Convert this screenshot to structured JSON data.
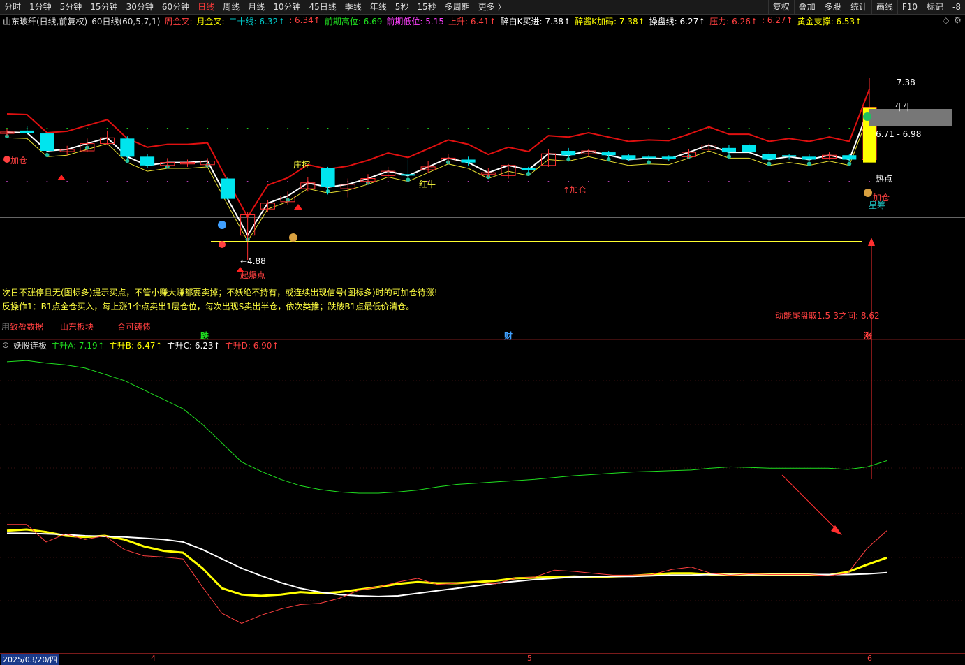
{
  "toolbar": {
    "periods": [
      "分时",
      "1分钟",
      "5分钟",
      "15分钟",
      "30分钟",
      "60分钟",
      "日线",
      "周线",
      "月线",
      "10分钟",
      "45日线",
      "季线",
      "年线",
      "5秒",
      "15秒",
      "多周期",
      "更多 〉"
    ],
    "active": "日线",
    "right_buttons": [
      "复权",
      "叠加",
      "多股",
      "统计",
      "画线",
      "F10",
      "标记",
      "-8"
    ]
  },
  "infobar": {
    "stock": "山东玻纤(日线,前复权)",
    "indicator": "60日线(60,5,7,1)",
    "items": [
      {
        "text": "周金叉:",
        "color": "#ff4040"
      },
      {
        "text": "月金叉:",
        "color": "#ffff00"
      },
      {
        "text": "二十线: 6.32↑",
        "color": "#00c8c8"
      },
      {
        "text": ": 6.34↑",
        "color": "#ff4040"
      },
      {
        "text": "前期高位: 6.69",
        "color": "#20e020"
      },
      {
        "text": "前期低位: 5.15",
        "color": "#ff40ff"
      },
      {
        "text": "上升: 6.41↑",
        "color": "#ff4040"
      },
      {
        "text": "醉白K买进: 7.38↑",
        "color": "#ffffff"
      },
      {
        "text": "醉酱K加码: 7.38↑",
        "color": "#ffff00"
      },
      {
        "text": "操盘线: 6.27↑",
        "color": "#ffffff"
      },
      {
        "text": "压力: 6.26↑",
        "color": "#ff4040"
      },
      {
        "text": ": 6.27↑",
        "color": "#ff4040"
      },
      {
        "text": "黄金支撑: 6.53↑",
        "color": "#ffff00"
      }
    ]
  },
  "controls": [
    "◇",
    "⚙"
  ],
  "annotations": {
    "jiacang1": "加仓",
    "zhuangkong": "庄控",
    "hongniu": "红牛",
    "jiacang2": "↑加仓",
    "price_high": "7.38",
    "range": "6.71 - 6.98",
    "niuniu": "牛牛",
    "redian": "热点",
    "jiacang3": "加仓",
    "xingchou": "星筹",
    "price_low": "←4.88",
    "qibaodian": "起爆点"
  },
  "notes": {
    "line1": "次日不涨停且无(图标多)提示买点，不管小赚大赚都要卖掉；不妖绝不持有，或连续出现信号(图标多)时的可加仓待涨!",
    "line2": "反操作1：B1点全仓买入，每上涨1个点卖出1层仓位，每次出现S卖出半仓，依次类推；跌破B1点最低价清仓。",
    "momentum": "动能尾盘取1.5-3之间:   8.62",
    "tags": [
      {
        "text": "用",
        "color": "#888"
      },
      {
        "text": "致盈数据",
        "color": "#ff4040"
      },
      {
        "text": "山东板块",
        "color": "#ff4040"
      },
      {
        "text": "合可铸债",
        "color": "#ff4040"
      }
    ],
    "markers": [
      {
        "text": "跌",
        "color": "#20e020"
      },
      {
        "text": "财",
        "color": "#40a0ff"
      },
      {
        "text": "涨",
        "color": "#ff4040"
      }
    ]
  },
  "sub_legend": {
    "title": "妖股连板",
    "items": [
      {
        "text": "主升A: 7.19↑",
        "color": "#20e020"
      },
      {
        "text": "主升B: 6.47↑",
        "color": "#ffff00"
      },
      {
        "text": "主升C: 6.23↑",
        "color": "#ffffff"
      },
      {
        "text": "主升D: 6.90↑",
        "color": "#ff4040"
      }
    ]
  },
  "bottom_axis": {
    "date": "2025/03/20/四",
    "months": [
      "4",
      "5",
      "6"
    ]
  },
  "chart_data": [
    {
      "type": "candlestick",
      "title": "山东玻纤(日线,前复权)",
      "annotated_high": 7.38,
      "annotated_low": 4.88,
      "annotated_range": [
        6.71,
        6.98
      ],
      "candles": [
        {
          "o": 6.62,
          "c": 6.64,
          "h": 6.68,
          "l": 6.58,
          "up": true
        },
        {
          "o": 6.66,
          "c": 6.63,
          "h": 6.72,
          "l": 6.6,
          "up": false
        },
        {
          "o": 6.62,
          "c": 6.38,
          "h": 6.64,
          "l": 6.3,
          "up": false
        },
        {
          "o": 6.37,
          "c": 6.4,
          "h": 6.45,
          "l": 6.32,
          "up": true
        },
        {
          "o": 6.38,
          "c": 6.48,
          "h": 6.55,
          "l": 6.36,
          "up": true
        },
        {
          "o": 6.48,
          "c": 6.56,
          "h": 6.66,
          "l": 6.46,
          "up": true
        },
        {
          "o": 6.55,
          "c": 6.3,
          "h": 6.58,
          "l": 6.26,
          "up": false
        },
        {
          "o": 6.3,
          "c": 6.18,
          "h": 6.34,
          "l": 6.14,
          "up": false
        },
        {
          "o": 6.18,
          "c": 6.22,
          "h": 6.28,
          "l": 6.14,
          "up": true
        },
        {
          "o": 6.2,
          "c": 6.22,
          "h": 6.26,
          "l": 6.16,
          "up": true
        },
        {
          "o": 6.19,
          "c": 6.24,
          "h": 6.28,
          "l": 6.16,
          "up": true
        },
        {
          "o": 6.0,
          "c": 5.72,
          "h": 6.02,
          "l": 5.7,
          "up": false
        },
        {
          "o": 5.5,
          "c": 5.22,
          "h": 5.54,
          "l": 4.88,
          "up": true
        },
        {
          "o": 5.58,
          "c": 5.66,
          "h": 5.7,
          "l": 5.54,
          "up": true
        },
        {
          "o": 5.68,
          "c": 5.76,
          "h": 5.82,
          "l": 5.64,
          "up": true
        },
        {
          "o": 5.86,
          "c": 5.94,
          "h": 6.02,
          "l": 5.82,
          "up": true
        },
        {
          "o": 6.14,
          "c": 5.88,
          "h": 6.16,
          "l": 5.78,
          "up": false
        },
        {
          "o": 5.86,
          "c": 5.92,
          "h": 6.0,
          "l": 5.74,
          "up": true
        },
        {
          "o": 5.96,
          "c": 6.0,
          "h": 6.06,
          "l": 5.92,
          "up": true
        },
        {
          "o": 6.04,
          "c": 6.1,
          "h": 6.16,
          "l": 6.0,
          "up": true
        },
        {
          "o": 6.06,
          "c": 6.04,
          "h": 6.26,
          "l": 6.0,
          "up": false
        },
        {
          "o": 6.12,
          "c": 6.16,
          "h": 6.24,
          "l": 6.08,
          "up": true
        },
        {
          "o": 6.24,
          "c": 6.28,
          "h": 6.34,
          "l": 6.2,
          "up": true
        },
        {
          "o": 6.26,
          "c": 6.22,
          "h": 6.3,
          "l": 6.18,
          "up": false
        },
        {
          "o": 6.06,
          "c": 6.08,
          "h": 6.14,
          "l": 6.02,
          "up": true
        },
        {
          "o": 6.04,
          "c": 6.18,
          "h": 6.2,
          "l": 6.0,
          "up": true
        },
        {
          "o": 6.14,
          "c": 6.12,
          "h": 6.16,
          "l": 6.08,
          "up": false
        },
        {
          "o": 6.18,
          "c": 6.34,
          "h": 6.4,
          "l": 6.16,
          "up": true
        },
        {
          "o": 6.38,
          "c": 6.32,
          "h": 6.42,
          "l": 6.28,
          "up": false
        },
        {
          "o": 6.34,
          "c": 6.38,
          "h": 6.4,
          "l": 6.3,
          "up": true
        },
        {
          "o": 6.36,
          "c": 6.32,
          "h": 6.38,
          "l": 6.28,
          "up": false
        },
        {
          "o": 6.32,
          "c": 6.26,
          "h": 6.34,
          "l": 6.24,
          "up": false
        },
        {
          "o": 6.3,
          "c": 6.28,
          "h": 6.32,
          "l": 6.26,
          "up": false
        },
        {
          "o": 6.3,
          "c": 6.27,
          "h": 6.32,
          "l": 6.24,
          "up": false
        },
        {
          "o": 6.3,
          "c": 6.36,
          "h": 6.4,
          "l": 6.28,
          "up": true
        },
        {
          "o": 6.4,
          "c": 6.46,
          "h": 6.48,
          "l": 6.36,
          "up": true
        },
        {
          "o": 6.42,
          "c": 6.36,
          "h": 6.46,
          "l": 6.34,
          "up": false
        },
        {
          "o": 6.46,
          "c": 6.36,
          "h": 6.48,
          "l": 6.34,
          "up": false
        },
        {
          "o": 6.34,
          "c": 6.26,
          "h": 6.36,
          "l": 6.24,
          "up": false
        },
        {
          "o": 6.32,
          "c": 6.3,
          "h": 6.34,
          "l": 6.26,
          "up": false
        },
        {
          "o": 6.3,
          "c": 6.26,
          "h": 6.34,
          "l": 6.24,
          "up": false
        },
        {
          "o": 6.28,
          "c": 6.32,
          "h": 6.36,
          "l": 6.26,
          "up": true
        },
        {
          "o": 6.32,
          "c": 6.26,
          "h": 6.34,
          "l": 6.24,
          "up": false
        },
        {
          "o": 6.26,
          "c": 6.98,
          "h": 7.38,
          "l": 6.22,
          "up": true
        }
      ]
    },
    {
      "type": "line",
      "title": "妖股连板",
      "series": [
        {
          "name": "主升A",
          "color": "#20e020",
          "values": [
            9.6,
            9.62,
            9.58,
            9.55,
            9.5,
            9.4,
            9.3,
            9.15,
            9.0,
            8.85,
            8.6,
            8.3,
            8.0,
            7.85,
            7.72,
            7.62,
            7.56,
            7.52,
            7.5,
            7.5,
            7.52,
            7.55,
            7.6,
            7.64,
            7.66,
            7.68,
            7.7,
            7.72,
            7.75,
            7.78,
            7.8,
            7.82,
            7.84,
            7.85,
            7.86,
            7.87,
            7.9,
            7.92,
            7.91,
            7.9,
            7.9,
            7.9,
            7.9,
            7.88,
            7.92,
            8.02
          ]
        },
        {
          "name": "主升B",
          "color": "#ffff00",
          "values": [
            6.9,
            6.92,
            6.88,
            6.82,
            6.8,
            6.82,
            6.76,
            6.65,
            6.58,
            6.55,
            6.3,
            5.98,
            5.88,
            5.86,
            5.88,
            5.92,
            5.9,
            5.92,
            5.96,
            6.0,
            6.05,
            6.08,
            6.06,
            6.06,
            6.08,
            6.1,
            6.14,
            6.15,
            6.16,
            6.17,
            6.16,
            6.17,
            6.18,
            6.2,
            6.22,
            6.22,
            6.2,
            6.2,
            6.2,
            6.2,
            6.2,
            6.2,
            6.19,
            6.24,
            6.36,
            6.47
          ]
        },
        {
          "name": "主升C",
          "color": "#ffffff",
          "values": [
            6.86,
            6.86,
            6.85,
            6.84,
            6.82,
            6.81,
            6.8,
            6.78,
            6.76,
            6.72,
            6.6,
            6.45,
            6.3,
            6.18,
            6.07,
            5.98,
            5.92,
            5.88,
            5.86,
            5.85,
            5.86,
            5.9,
            5.94,
            5.98,
            6.02,
            6.06,
            6.09,
            6.12,
            6.14,
            6.16,
            6.17,
            6.17,
            6.17,
            6.18,
            6.19,
            6.19,
            6.2,
            6.2,
            6.2,
            6.2,
            6.2,
            6.2,
            6.2,
            6.2,
            6.21,
            6.23
          ]
        },
        {
          "name": "主升D",
          "color": "#ff4040",
          "values": [
            7.0,
            7.0,
            6.72,
            6.85,
            6.76,
            6.82,
            6.6,
            6.5,
            6.48,
            6.45,
            6.0,
            5.58,
            5.42,
            5.55,
            5.65,
            5.72,
            5.74,
            5.82,
            5.95,
            6.0,
            6.08,
            6.14,
            6.04,
            6.06,
            6.07,
            6.05,
            6.14,
            6.16,
            6.27,
            6.25,
            6.22,
            6.19,
            6.19,
            6.2,
            6.28,
            6.32,
            6.22,
            6.19,
            6.21,
            6.2,
            6.2,
            6.2,
            6.18,
            6.22,
            6.62,
            6.9
          ]
        }
      ]
    }
  ]
}
